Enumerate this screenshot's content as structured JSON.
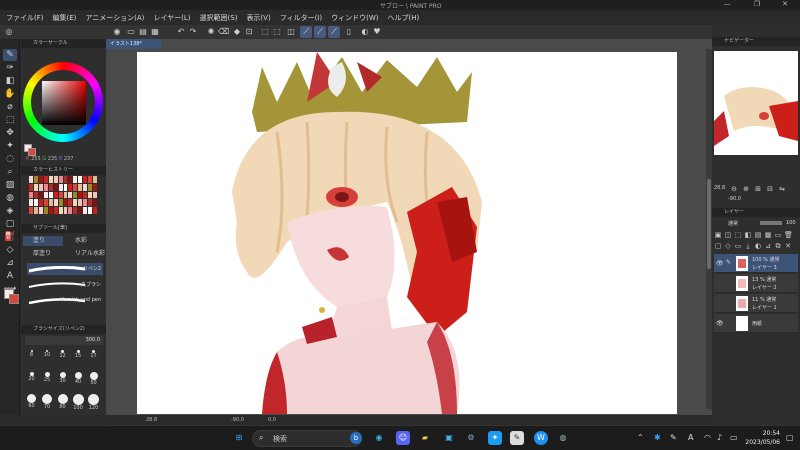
{
  "titlebar": {
    "title": "サブロー                              \\ PAINT PRO",
    "minimize": "—",
    "maximize": "❐",
    "close": "✕"
  },
  "menu": [
    "ファイル(F)",
    "編集(E)",
    "アニメーション(A)",
    "レイヤー(L)",
    "選択範囲(S)",
    "表示(V)",
    "フィルター(I)",
    "ウィンドウ(W)",
    "ヘルプ(H)"
  ],
  "left": {
    "color_circle_header": "カラーサークル",
    "rgb": {
      "r": "255",
      "g": "235",
      "b": "237"
    },
    "history_header": "カラーヒストリー",
    "subtool_header": "サブツール[筆]",
    "brush_tabs": {
      "tab1": "塗り",
      "tab2": "水彩",
      "tab3": "厚塗り",
      "tab4": "リアル水彩"
    },
    "brushes": [
      "リペン2",
      "丸ブラシ",
      "Varnish und pen"
    ],
    "brush_size_header": "ブラシサイズ(リペン2)",
    "brush_size_value": "300.0",
    "sizes": [
      "8",
      "10",
      "12",
      "15",
      "17",
      "20",
      "25",
      "30",
      "40",
      "50",
      "60",
      "70",
      "80",
      "100",
      "120"
    ]
  },
  "canvas": {
    "tab": "イラスト138*",
    "zoom": "28.8",
    "angle": "-90.0",
    "coord": "0.0"
  },
  "right": {
    "navigator_header": "ナビゲーター",
    "nav_zoom": "28.8",
    "nav_angle": "-90.0",
    "layer_header": "レイヤー",
    "blend_mode": "通常",
    "opacity": "100",
    "layers": [
      {
        "line1": "100 % 通常",
        "line2": "レイヤー 3",
        "selected": true
      },
      {
        "line1": "13 % 通常",
        "line2": "レイヤー 2",
        "selected": false
      },
      {
        "line1": "11 % 通常",
        "line2": "レイヤー 1",
        "selected": false
      },
      {
        "line1": "",
        "line2": "用紙",
        "selected": false
      }
    ]
  },
  "taskbar": {
    "search_label": "検索",
    "ime": "A",
    "time": "20:54",
    "date": "2023/05/06"
  },
  "colors": {
    "accent": "#3c5478",
    "canvas_bg": "#4a4a4a",
    "panel": "#2e2e2e"
  }
}
